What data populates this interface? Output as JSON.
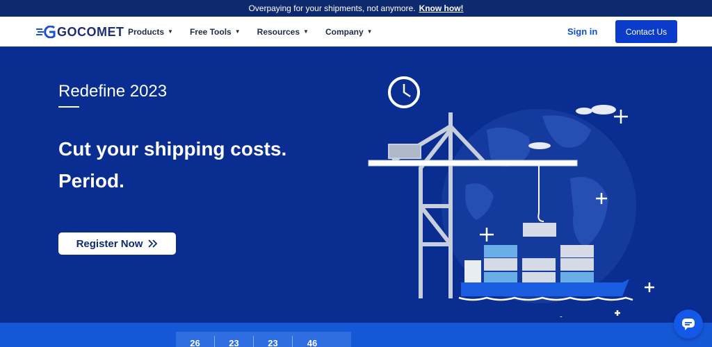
{
  "announcement": {
    "text": "Overpaying for your shipments, not anymore.",
    "link": "Know how!"
  },
  "nav": {
    "logo_text": "GOCOMET",
    "menu": [
      {
        "label": "Products"
      },
      {
        "label": "Free Tools"
      },
      {
        "label": "Resources"
      },
      {
        "label": "Company"
      }
    ],
    "signin": "Sign in",
    "contact": "Contact Us"
  },
  "hero": {
    "eyebrow": "Redefine 2023",
    "headline_1": "Cut your shipping costs.",
    "headline_2": "Period.",
    "cta": "Register Now",
    "cta_icon": "double-chevron-right-icon"
  },
  "countdown": [
    "26",
    "23",
    "23",
    "46"
  ],
  "colors": {
    "hero_bg": "#0a2d91",
    "accent": "#0a3cc9",
    "topbar": "#0e2a6e"
  }
}
